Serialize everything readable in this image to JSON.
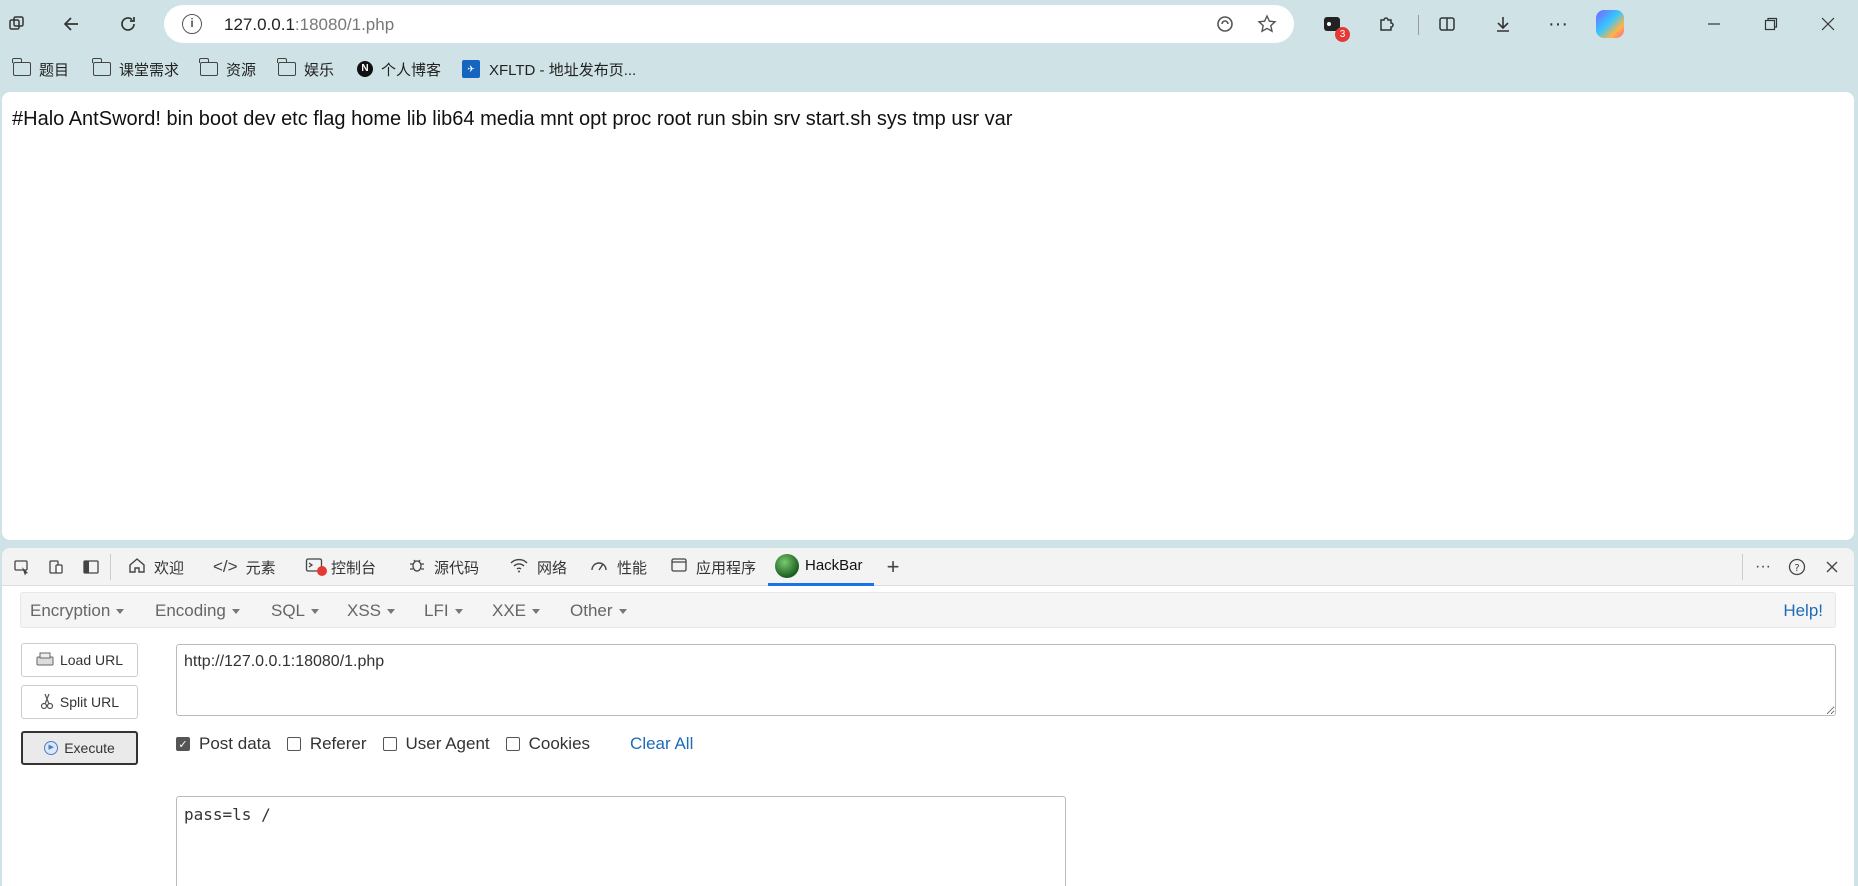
{
  "browser": {
    "address": {
      "host": "127.0.0.1",
      "rest": ":18080/1.php"
    },
    "extensions_badge": "3"
  },
  "bookmarks": [
    {
      "label": "题目",
      "icon": "folder-icon"
    },
    {
      "label": "课堂需求",
      "icon": "folder-icon"
    },
    {
      "label": "资源",
      "icon": "folder-icon"
    },
    {
      "label": "娱乐",
      "icon": "folder-icon"
    },
    {
      "label": "个人博客",
      "icon": "n-logo-icon",
      "logo": "N"
    },
    {
      "label": "XFLTD - 地址发布页...",
      "icon": "xfltd-logo-icon"
    }
  ],
  "page": {
    "output": "#Halo AntSword! bin boot dev etc flag home lib lib64 media mnt opt proc root run sbin srv start.sh sys tmp usr var"
  },
  "devtools": {
    "tabs": [
      {
        "label": "欢迎",
        "icon": "home-icon"
      },
      {
        "label": "元素",
        "icon": "code-icon"
      },
      {
        "label": "控制台",
        "icon": "console-icon"
      },
      {
        "label": "源代码",
        "icon": "bug-icon"
      },
      {
        "label": "网络",
        "icon": "wifi-icon"
      },
      {
        "label": "性能",
        "icon": "gauge-icon"
      },
      {
        "label": "应用程序",
        "icon": "window-icon"
      },
      {
        "label": "HackBar",
        "icon": "hackbar-logo-icon",
        "active": true
      }
    ]
  },
  "hackbar": {
    "menus": [
      "Encoding",
      "SQL",
      "XSS",
      "LFI",
      "XXE",
      "Other"
    ],
    "menu_first": "Encryption",
    "help": "Help!",
    "buttons": {
      "load": "Load URL",
      "split": "Split URL",
      "execute": "Execute"
    },
    "url": "http://127.0.0.1:18080/1.php",
    "checks": {
      "post": {
        "label": "Post data",
        "checked": true
      },
      "referer": {
        "label": "Referer",
        "checked": false
      },
      "ua": {
        "label": "User Agent",
        "checked": false
      },
      "cookies": {
        "label": "Cookies",
        "checked": false
      }
    },
    "clear_all": "Clear All",
    "post_body": "pass=ls /"
  },
  "colors": {
    "accent": "#1a73e8",
    "link": "#1e6bb8",
    "frame": "#cfe3e6"
  }
}
